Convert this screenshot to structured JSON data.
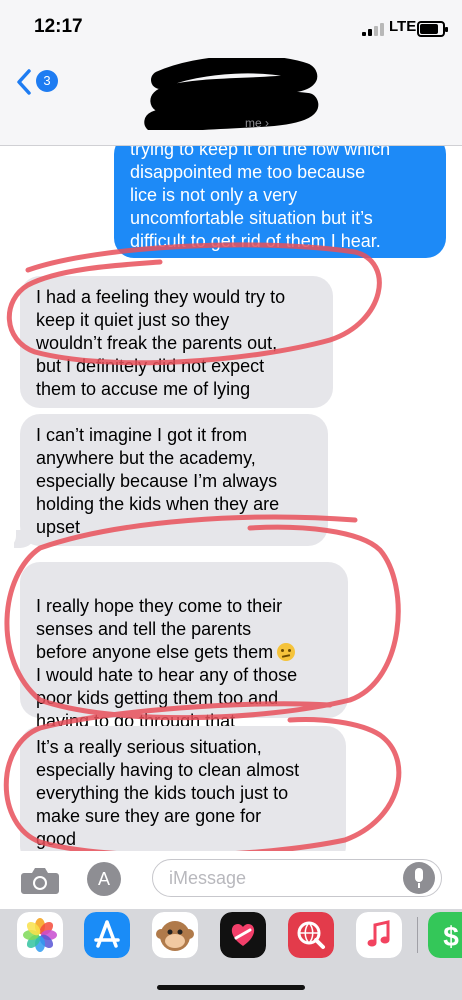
{
  "status_bar": {
    "time": "12:17",
    "network": "LTE"
  },
  "nav_bar": {
    "back_count": "3",
    "contact_name": "me"
  },
  "messages": [
    {
      "type": "sent",
      "lines": "trying to keep it on the low which\ndisappointed me too because\nlice is not only a very\nuncomfortable situation but it’s\ndifficult to get rid of them I hear."
    },
    {
      "type": "received",
      "lines": "I had a feeling they would try to\nkeep it quiet just so they\nwouldn’t freak the parents out,\nbut I definitely did not expect\nthem to accuse me of lying"
    },
    {
      "type": "received",
      "lines": "I can’t imagine I got it from\nanywhere but the academy,\nespecially because I’m always\nholding the kids when they are\nupset"
    },
    {
      "type": "received",
      "lines_before_emoji": "I really hope they come to their\nsenses and tell the parents\nbefore anyone else gets them",
      "lines_after_emoji": "I would hate to hear any of those\npoor kids getting them too and\nhaving to go through that",
      "emoji": "confused-face"
    },
    {
      "type": "received",
      "lines": "It’s a really serious situation,\nespecially having to clean almost\neverything the kids touch just to\nmake sure they are gone for\ngood"
    }
  ],
  "input_bar": {
    "placeholder": "iMessage",
    "value": ""
  },
  "app_drawer": {
    "apps": [
      {
        "icon": "photos-icon",
        "color": "#ffffff"
      },
      {
        "icon": "app-store-icon",
        "color": "#1a8cf7"
      },
      {
        "icon": "animoji-icon",
        "color": "#ffffff"
      },
      {
        "icon": "digital-touch-icon",
        "color": "#111111"
      },
      {
        "icon": "web-search-icon",
        "color": "#e33b4b"
      },
      {
        "icon": "music-icon",
        "color": "#ffffff"
      },
      {
        "icon": "apple-pay-icon",
        "color": "#34c759"
      }
    ]
  },
  "annotation_color": "#e8505b"
}
